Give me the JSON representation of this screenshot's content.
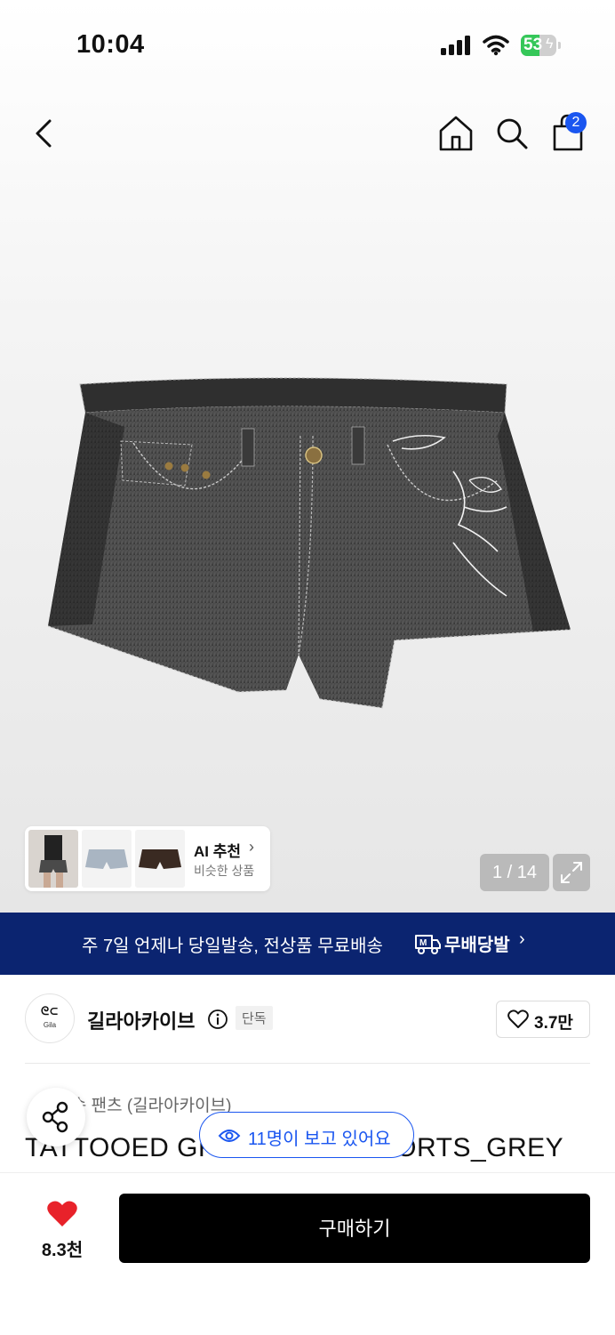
{
  "status_bar": {
    "time": "10:04",
    "battery": "53",
    "battery_level": 0.53
  },
  "header": {
    "cart_count": "2"
  },
  "product": {
    "image_alt": "TATTOOED GREY DENIM SHORTS_GREY",
    "page_current": "1",
    "page_total": "14",
    "page_label": "1 / 14"
  },
  "ai_recommend": {
    "title": "AI 추천",
    "subtitle": "비슷한 상품"
  },
  "promo": {
    "text": "주 7일 언제나 당일발송, 전상품 무료배송",
    "brand": "무배당발"
  },
  "brand": {
    "name": "길라아카이브",
    "logo_text": "Gila",
    "badge": "단독",
    "likes": "3.7만"
  },
  "info": {
    "breadcrumb": "바지 > 숏 팬츠 (길라아카이브)",
    "breadcrumb_visible": "숏 팬츠 (길라아카이브)",
    "title": "TATTOOED GREY DENIM SHORTS_GREY"
  },
  "viewers": {
    "text": "11명이 보고 있어요"
  },
  "bottom": {
    "wishlist_count": "8.3천",
    "buy_label": "구매하기"
  },
  "colors": {
    "accent_blue": "#1a56f0",
    "banner_navy": "#0b2470",
    "heart_red": "#e8222a",
    "battery_green": "#35c759"
  }
}
